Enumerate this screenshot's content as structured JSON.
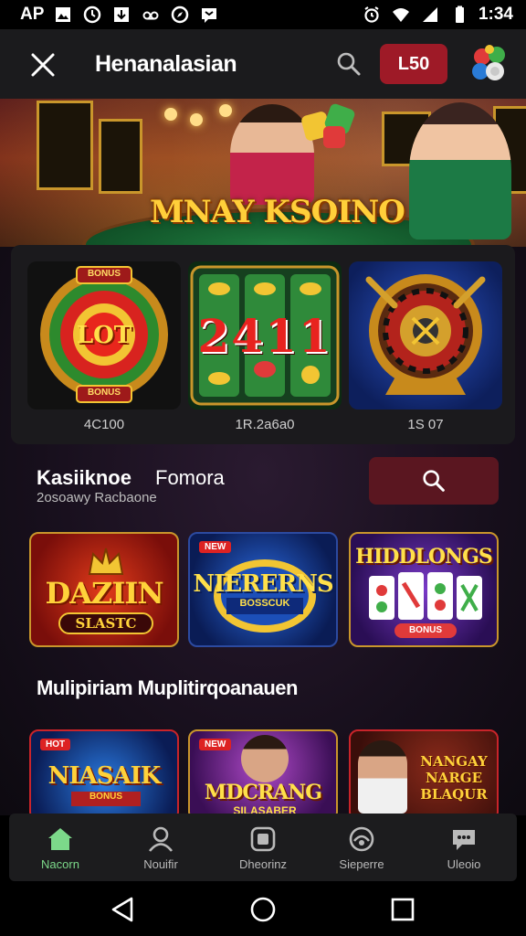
{
  "status_bar": {
    "left_text": "AP",
    "time": "1:34",
    "icons_left": [
      "photo-icon",
      "clock-icon",
      "download-icon",
      "voicemail-icon",
      "compass-icon",
      "message-icon"
    ],
    "icons_right": [
      "alarm-icon",
      "wifi-icon",
      "signal-icon",
      "battery-icon"
    ]
  },
  "header": {
    "title": "Henanalasian",
    "balance_label": "L50",
    "accent": "#9e1a27"
  },
  "banner": {
    "title": "MNAY KSOINO"
  },
  "featured": {
    "cards": [
      {
        "label": "4C100",
        "badge_top": "BONUS",
        "center_text": "LOT",
        "badge_bottom": "BONUS"
      },
      {
        "label": "1R.2a6a0",
        "center_text": "2411"
      },
      {
        "label": "1S 07"
      }
    ]
  },
  "section": {
    "title": "Kasiiknoe",
    "title_right": "Fomora",
    "subtitle": "2osoawy Racbaone"
  },
  "games_row1": [
    {
      "title": "DAZIIN",
      "subtitle": "SLASTC"
    },
    {
      "title": "NIERERNS",
      "badge": "NEW",
      "subtitle": "BOSSCUK"
    },
    {
      "title": "HIDDLONGS",
      "subtitle": "BONUS"
    }
  ],
  "multi_section": {
    "title": "Mulipiriam Muplitirqoanauen"
  },
  "games_row2": [
    {
      "title": "NIASAIK",
      "badge": "HOT",
      "subtitle": "BONUS"
    },
    {
      "title": "MDCRANG",
      "badge": "NEW",
      "subtitle": "SILASABER"
    },
    {
      "title": "NANGAY NARGE BLAQUR"
    }
  ],
  "bottom_nav": [
    {
      "label": "Nacorn",
      "icon": "home-icon",
      "active": true
    },
    {
      "label": "Nouifir",
      "icon": "profile-icon",
      "active": false
    },
    {
      "label": "Dheorinz",
      "icon": "games-icon",
      "active": false
    },
    {
      "label": "Sieperre",
      "icon": "support-icon",
      "active": false
    },
    {
      "label": "Uleoio",
      "icon": "chat-icon",
      "active": false
    }
  ],
  "colors": {
    "active_nav": "#7cd98a",
    "gold": "#ffcf3a"
  }
}
